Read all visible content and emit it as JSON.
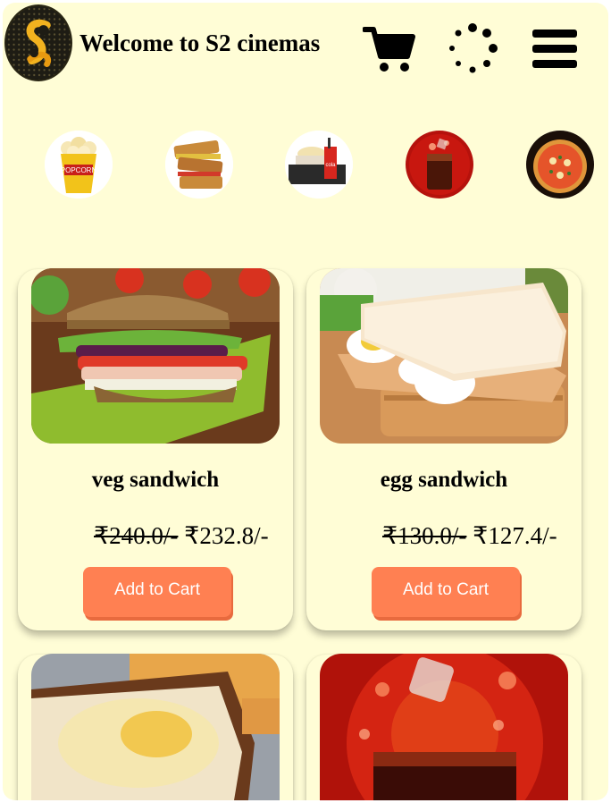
{
  "header": {
    "title": "Welcome to S2 cinemas",
    "logo_alt": "S2 logo",
    "icons": [
      "cart-icon",
      "loading-icon",
      "menu-icon"
    ]
  },
  "categories": [
    {
      "name": "popcorn",
      "icon": "popcorn-image"
    },
    {
      "name": "sandwich",
      "icon": "sandwich-image"
    },
    {
      "name": "combo",
      "icon": "combo-image"
    },
    {
      "name": "cold drink",
      "icon": "cola-image"
    },
    {
      "name": "pizza",
      "icon": "pizza-image"
    }
  ],
  "products": [
    {
      "name": "veg sandwich",
      "old_price": "₹240.0/-",
      "new_price": "₹232.8/-",
      "button": "Add to Cart"
    },
    {
      "name": "egg sandwich",
      "old_price": "₹130.0/-",
      "new_price": "₹127.4/-",
      "button": "Add to Cart"
    },
    {
      "name": "",
      "old_price": "",
      "new_price": "",
      "button": ""
    },
    {
      "name": "",
      "old_price": "",
      "new_price": "",
      "button": ""
    }
  ],
  "colors": {
    "background": "#fffdd6",
    "button": "#ff8052",
    "button_text": "#ffffff",
    "logo_gold": "#f2b21f"
  }
}
